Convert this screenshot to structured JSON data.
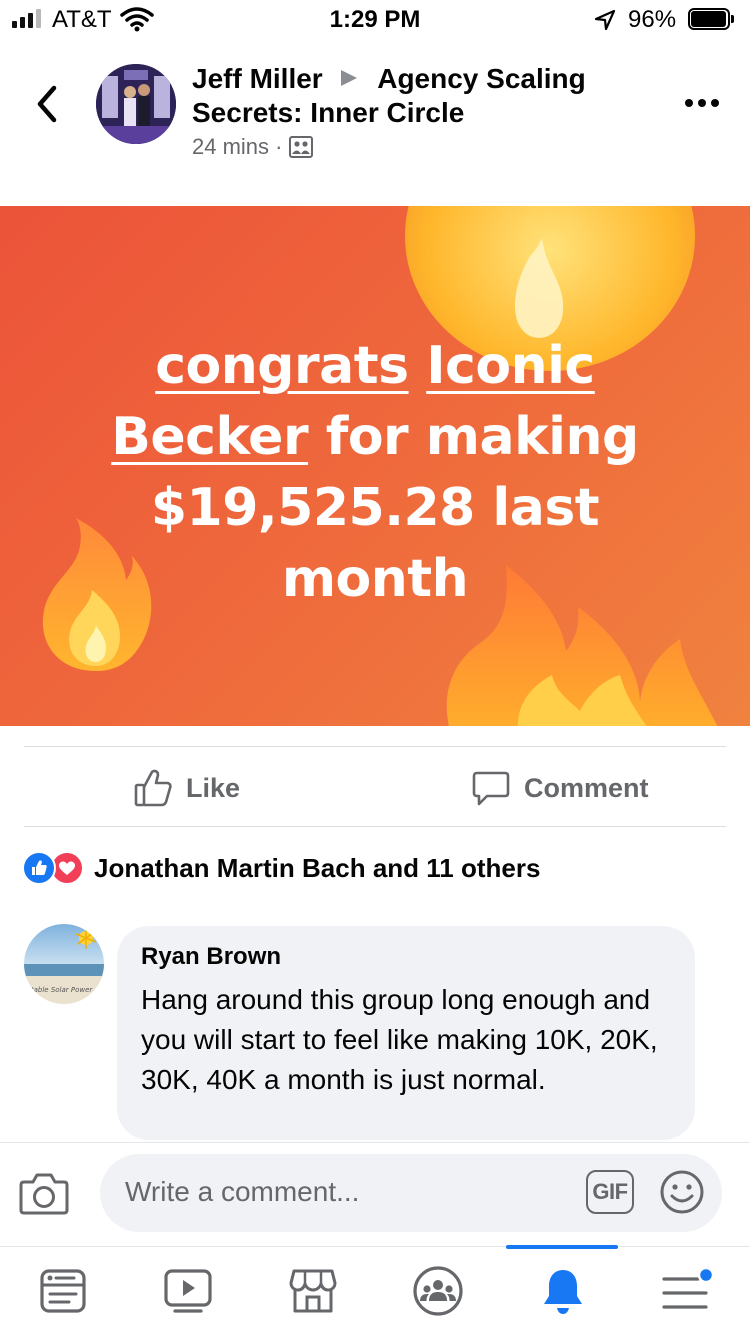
{
  "status_bar": {
    "carrier": "AT&T",
    "time": "1:29 PM",
    "battery_percent": "96%",
    "battery_level": 0.96
  },
  "post_header": {
    "author": "Jeff Miller",
    "group": "Agency Scaling Secrets: Inner Circle",
    "group_line1": "Agency Scaling",
    "group_line2": "Secrets: Inner Circle",
    "time_ago": "24 mins",
    "separator": "·"
  },
  "banner": {
    "background_color": "#ee5f3a",
    "text_line1_a": "congrats",
    "text_line1_b": "Iconic",
    "text_line2_a": "Becker",
    "text_line2_b": " for making",
    "text_line3": "$19,525.28 last",
    "text_line4": "month"
  },
  "actions": {
    "like_label": "Like",
    "comment_label": "Comment"
  },
  "reactions": {
    "summary": "Jonathan Martin Bach and 11 others",
    "types": [
      "like-icon",
      "love-icon"
    ]
  },
  "comment": {
    "author": "Ryan Brown",
    "text": "Hang around this group long enough and you will start to feel like making 10K, 20K, 30K, 40K a month is just normal.",
    "avatar_caption": "rtable Solar Power"
  },
  "composer": {
    "placeholder": "Write a comment...",
    "gif_label": "GIF"
  },
  "tab_bar": {
    "tabs": [
      "news-feed-icon",
      "watch-icon",
      "marketplace-icon",
      "groups-icon",
      "notifications-icon",
      "menu-icon"
    ],
    "active_tab": "notifications-icon",
    "accent_color": "#1877f2"
  }
}
